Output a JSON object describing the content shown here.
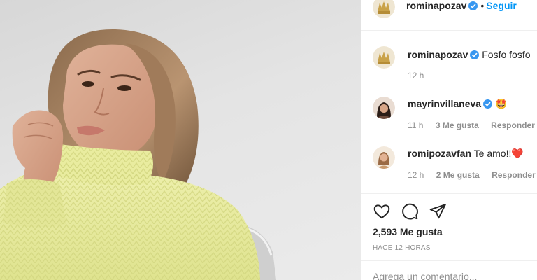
{
  "post": {
    "author": "rominapozav",
    "follow_separator": "•",
    "follow_label": "Seguir",
    "caption_author": "rominapozav",
    "caption_text": "Fosfo fosfo",
    "caption_time": "12 h"
  },
  "comments": [
    {
      "username": "mayrinvillaneva",
      "verified": true,
      "text": "🤩",
      "time": "11 h",
      "likes": "3 Me gusta",
      "reply_label": "Responder"
    },
    {
      "username": "romipozavfan",
      "verified": false,
      "text": "Te amo!!❤️",
      "time": "12 h",
      "likes": "2 Me gusta",
      "reply_label": "Responder"
    }
  ],
  "stats": {
    "likes": "2,593 Me gusta",
    "posted": "HACE 12 HORAS"
  },
  "add_comment": {
    "placeholder": "Agrega un comentario..."
  },
  "icons": [
    "heart-icon",
    "comment-icon",
    "share-icon",
    "verified-badge-icon"
  ],
  "colors": {
    "link_blue": "#0095f6",
    "verified_blue": "#3897f0",
    "text": "#262626",
    "muted": "#8e8e8e",
    "sweater_yellow": "#e6ea9c"
  }
}
